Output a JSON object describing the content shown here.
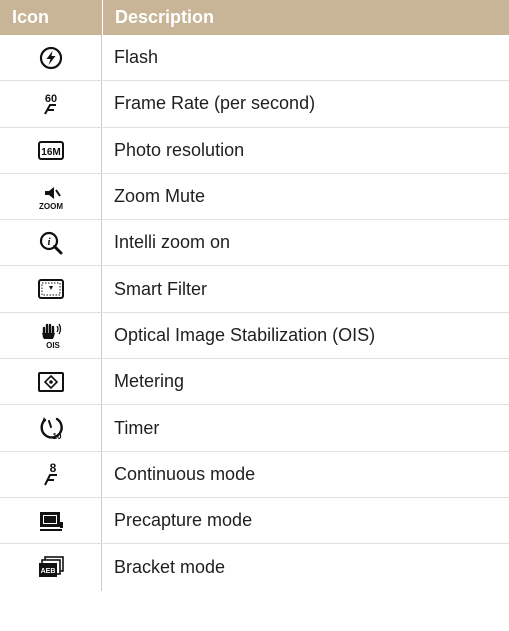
{
  "header": {
    "icon": "Icon",
    "description": "Description"
  },
  "rows": [
    {
      "icon": "flash-icon",
      "label": "Flash"
    },
    {
      "icon": "frame-rate-icon",
      "label": "Frame Rate (per second)"
    },
    {
      "icon": "photo-resolution-icon",
      "label": "Photo resolution"
    },
    {
      "icon": "zoom-mute-icon",
      "label": "Zoom Mute"
    },
    {
      "icon": "intelli-zoom-icon",
      "label": "Intelli zoom on"
    },
    {
      "icon": "smart-filter-icon",
      "label": "Smart Filter"
    },
    {
      "icon": "ois-icon",
      "label": "Optical Image Stabilization (OIS)"
    },
    {
      "icon": "metering-icon",
      "label": "Metering"
    },
    {
      "icon": "timer-icon",
      "label": "Timer"
    },
    {
      "icon": "continuous-mode-icon",
      "label": "Continuous mode"
    },
    {
      "icon": "precapture-mode-icon",
      "label": "Precapture mode"
    },
    {
      "icon": "bracket-mode-icon",
      "label": "Bracket mode"
    }
  ],
  "colors": {
    "header_bg": "#c8b496",
    "header_text": "#ffffff",
    "text": "#1f1f1f"
  },
  "icon_glyphs": {
    "frame_rate": "60",
    "photo_resolution": "16M",
    "zoom": "ZOOM",
    "ois": "OIS",
    "timer": "10",
    "continuous": "8",
    "bracket": "AEB"
  }
}
